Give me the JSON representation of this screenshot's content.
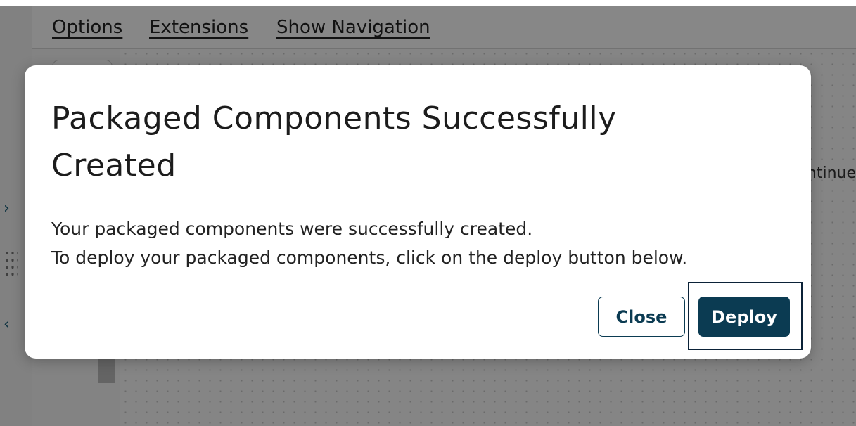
{
  "menubar": {
    "items": [
      {
        "label": "Options"
      },
      {
        "label": "Extensions"
      },
      {
        "label": "Show Navigation"
      }
    ]
  },
  "background": {
    "partial_text": "ntinue"
  },
  "modal": {
    "title": "Packaged Components Successfully Created",
    "body_lines": [
      "Your packaged components were successfully created.",
      "To deploy your packaged components, click on the deploy button below."
    ],
    "buttons": {
      "close_label": "Close",
      "deploy_label": "Deploy"
    }
  },
  "colors": {
    "primary": "#0b3b52",
    "overlay": "rgba(0,0,0,0.47)",
    "accent_icon": "#1a5f7a"
  },
  "icons": [
    "chevron-right-icon",
    "chevron-left-icon",
    "drag-grip-icon"
  ]
}
